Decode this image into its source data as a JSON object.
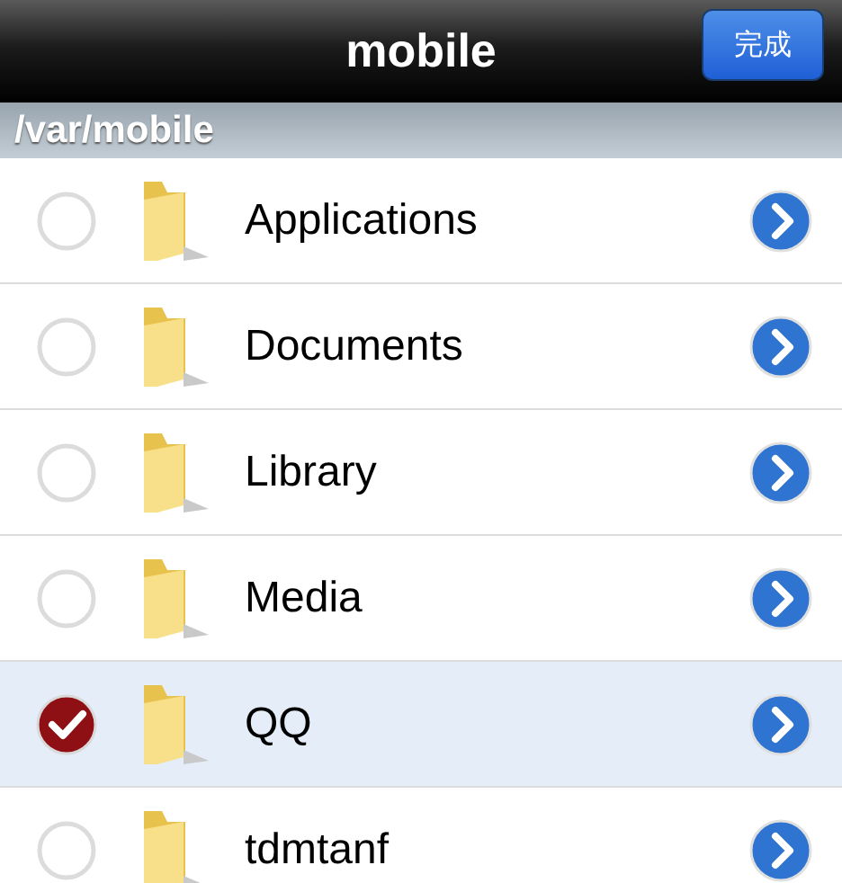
{
  "nav_bar": {
    "title": "mobile",
    "done_button": "完成"
  },
  "path": "/var/mobile",
  "items": [
    {
      "name": "Applications",
      "selected": false
    },
    {
      "name": "Documents",
      "selected": false
    },
    {
      "name": "Library",
      "selected": false
    },
    {
      "name": "Media",
      "selected": false
    },
    {
      "name": "QQ",
      "selected": true
    },
    {
      "name": "tdmtanf",
      "selected": false
    }
  ]
}
